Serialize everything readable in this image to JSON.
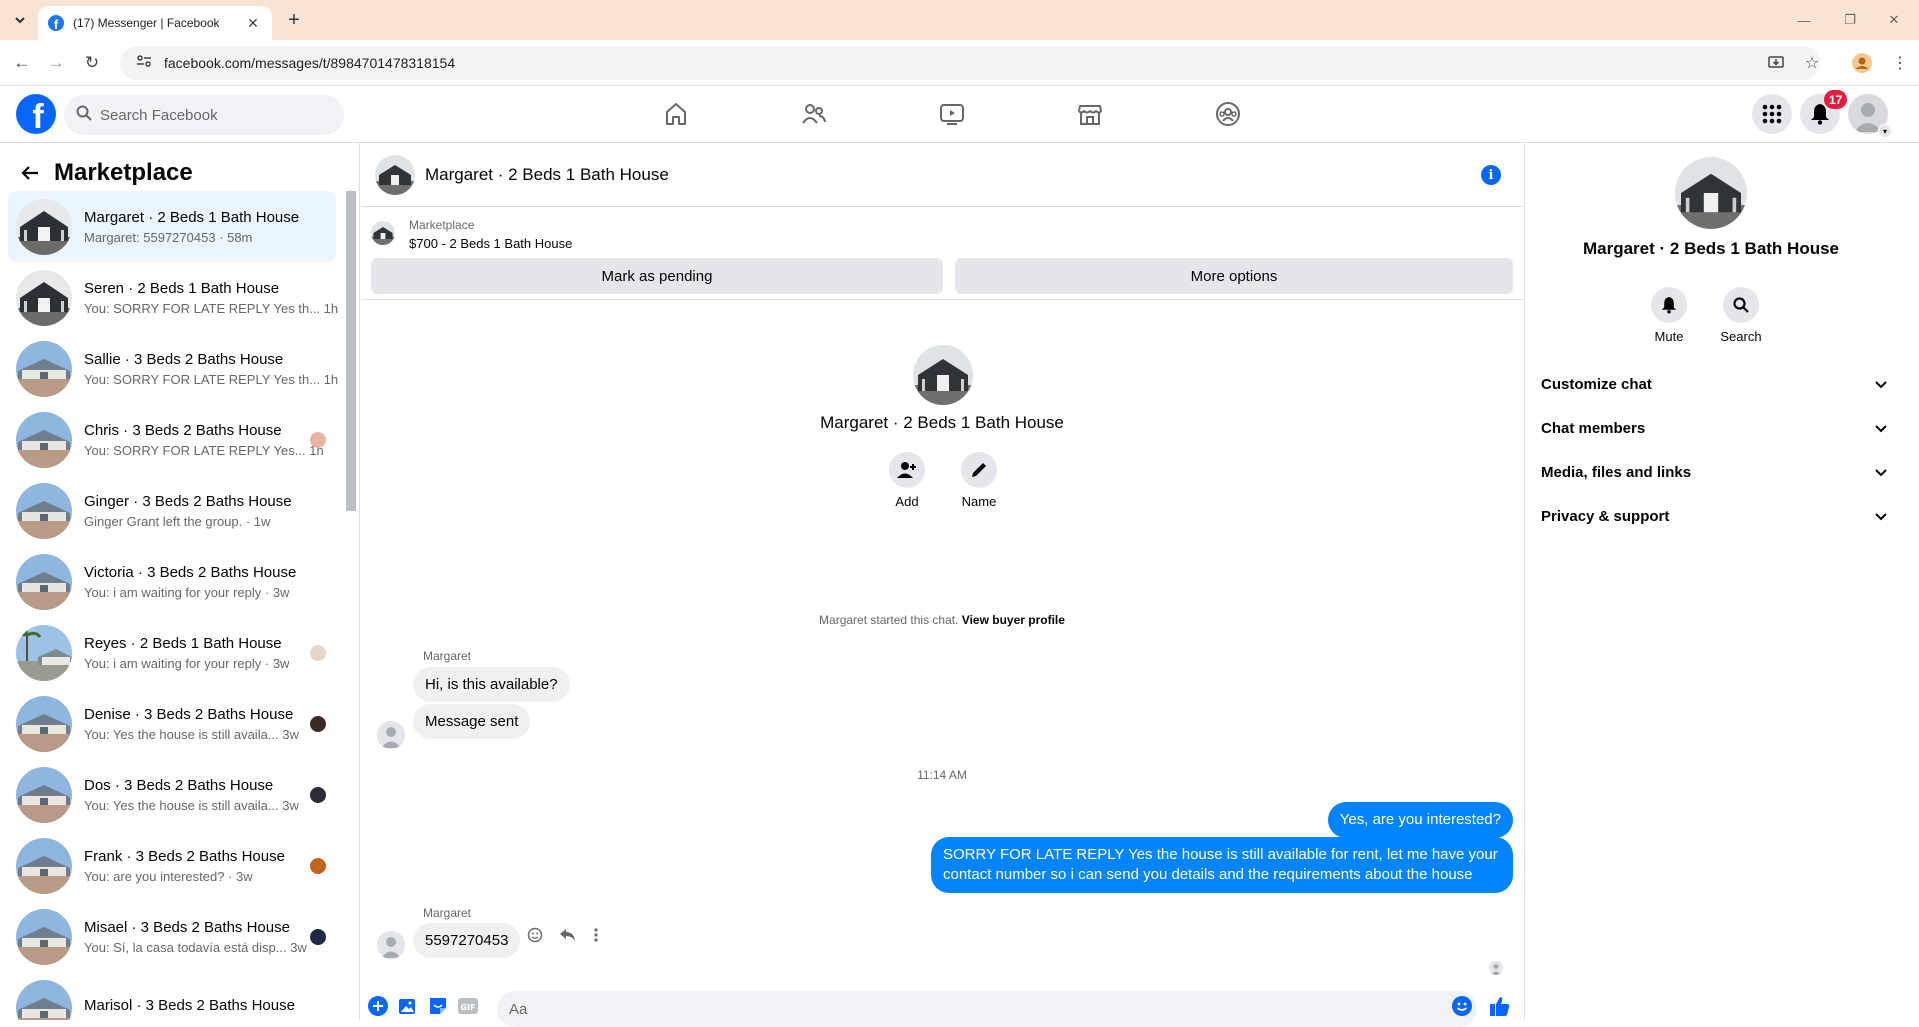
{
  "browser": {
    "tab_title": "(17) Messenger | Facebook",
    "url": "facebook.com/messages/t/8984701478318154"
  },
  "header": {
    "search_placeholder": "Search Facebook",
    "notification_count": "17"
  },
  "sidebar": {
    "title": "Marketplace",
    "conversations": [
      {
        "name": "Margaret · 2 Beds 1 Bath House",
        "snippet": "Margaret: 5597270453 · 58m",
        "active": true,
        "thumb": "dark"
      },
      {
        "name": "Seren · 2 Beds 1 Bath House",
        "snippet": "You: SORRY FOR LATE REPLY Yes th...  1h",
        "thumb": "dark"
      },
      {
        "name": "Sallie · 3 Beds 2 Baths House",
        "snippet": "You: SORRY FOR LATE REPLY Yes th...  1h",
        "thumb": "sky"
      },
      {
        "name": "Chris · 3 Beds 2 Baths House",
        "snippet": "You: SORRY FOR LATE REPLY Yes...  1h",
        "thumb": "sky",
        "seen": "#e8b4a0"
      },
      {
        "name": "Ginger · 3 Beds 2 Baths House",
        "snippet": "Ginger Grant left the group. · 1w",
        "thumb": "sky"
      },
      {
        "name": "Victoria · 3 Beds 2 Baths House",
        "snippet": "You: i am waiting for your reply · 3w",
        "thumb": "sky"
      },
      {
        "name": "Reyes · 2 Beds 1 Bath House",
        "snippet": "You: i am waiting for your reply · 3w",
        "thumb": "palm",
        "seen": "#e6d6c8"
      },
      {
        "name": "Denise · 3 Beds 2 Baths House",
        "snippet": "You: Yes the house is still availa...  3w",
        "thumb": "sky",
        "seen": "#3a2a22"
      },
      {
        "name": "Dos · 3 Beds 2 Baths House",
        "snippet": "You: Yes the house is still availa...  3w",
        "thumb": "sky",
        "seen": "#2d2d3a"
      },
      {
        "name": "Frank · 3 Beds 2 Baths House",
        "snippet": "You: are you interested? · 3w",
        "thumb": "sky",
        "seen": "#c0651e"
      },
      {
        "name": "Misael · 3 Beds 2 Baths House",
        "snippet": "You: Sí, la casa todavía está disp...  3w",
        "thumb": "sky",
        "seen": "#1f2a44"
      },
      {
        "name": "Marisol · 3 Beds 2 Baths House",
        "snippet": "",
        "thumb": "sky"
      }
    ]
  },
  "chat": {
    "title": "Margaret · 2 Beds 1 Bath House",
    "marketplace_label": "Marketplace",
    "listing": "$700 - 2 Beds 1 Bath House",
    "mark_pending": "Mark as pending",
    "more_options": "More options",
    "intro_name": "Margaret · 2 Beds 1 Bath House",
    "add_label": "Add",
    "name_label": "Name",
    "started_text": "Margaret started this chat.",
    "view_profile": "View buyer profile",
    "sender": "Margaret",
    "msg1": "Hi, is this available?",
    "msg2": "Message sent",
    "timestamp": "11:14 AM",
    "out1": "Yes, are you interested?",
    "out2": "SORRY FOR LATE REPLY Yes the house is still available for rent, let me have your contact number so i can send you details and the requirements about the house",
    "sender2": "Margaret",
    "msg3": "5597270453",
    "composer_placeholder": "Aa"
  },
  "details": {
    "name": "Margaret · 2 Beds 1 Bath House",
    "mute_label": "Mute",
    "search_label": "Search",
    "sections": [
      "Customize chat",
      "Chat members",
      "Media, files and links",
      "Privacy & support"
    ]
  },
  "colors": {
    "brand": "#0866ff",
    "outgoing_bubble": "#0084ff",
    "active_row": "#ebf5ff",
    "badge": "#e41e3f"
  }
}
